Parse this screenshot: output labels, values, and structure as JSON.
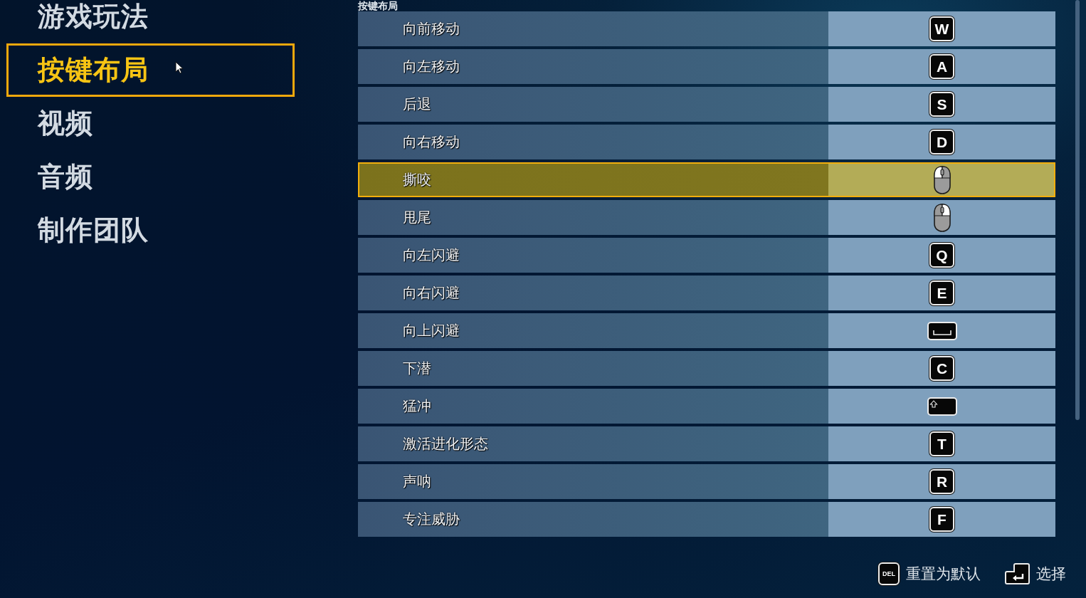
{
  "sidebar": {
    "items": [
      {
        "label": "游戏玩法",
        "selected": false
      },
      {
        "label": "按键布局",
        "selected": true
      },
      {
        "label": "视频",
        "selected": false
      },
      {
        "label": "音频",
        "selected": false
      },
      {
        "label": "制作团队",
        "selected": false
      }
    ]
  },
  "section_title": "按键布局",
  "bindings": [
    {
      "action": "向前移动",
      "selected": false,
      "key": {
        "kind": "key",
        "label": "W"
      }
    },
    {
      "action": "向左移动",
      "selected": false,
      "key": {
        "kind": "key",
        "label": "A"
      }
    },
    {
      "action": "后退",
      "selected": false,
      "key": {
        "kind": "key",
        "label": "S"
      }
    },
    {
      "action": "向右移动",
      "selected": false,
      "key": {
        "kind": "key",
        "label": "D"
      }
    },
    {
      "action": "撕咬",
      "selected": true,
      "key": {
        "kind": "mouse-left"
      }
    },
    {
      "action": "甩尾",
      "selected": false,
      "key": {
        "kind": "mouse-right"
      }
    },
    {
      "action": "向左闪避",
      "selected": false,
      "key": {
        "kind": "key",
        "label": "Q"
      }
    },
    {
      "action": "向右闪避",
      "selected": false,
      "key": {
        "kind": "key",
        "label": "E"
      }
    },
    {
      "action": "向上闪避",
      "selected": false,
      "key": {
        "kind": "space"
      }
    },
    {
      "action": "下潜",
      "selected": false,
      "key": {
        "kind": "key",
        "label": "C"
      }
    },
    {
      "action": "猛冲",
      "selected": false,
      "key": {
        "kind": "shift"
      }
    },
    {
      "action": "激活进化形态",
      "selected": false,
      "key": {
        "kind": "key",
        "label": "T"
      }
    },
    {
      "action": "声呐",
      "selected": false,
      "key": {
        "kind": "key",
        "label": "R"
      }
    },
    {
      "action": "专注威胁",
      "selected": false,
      "key": {
        "kind": "key",
        "label": "F"
      }
    }
  ],
  "footer_hints": [
    {
      "key": {
        "kind": "key",
        "label": "DEL"
      },
      "label": "重置为默认"
    },
    {
      "key": {
        "kind": "enter"
      },
      "label": "选择"
    }
  ]
}
